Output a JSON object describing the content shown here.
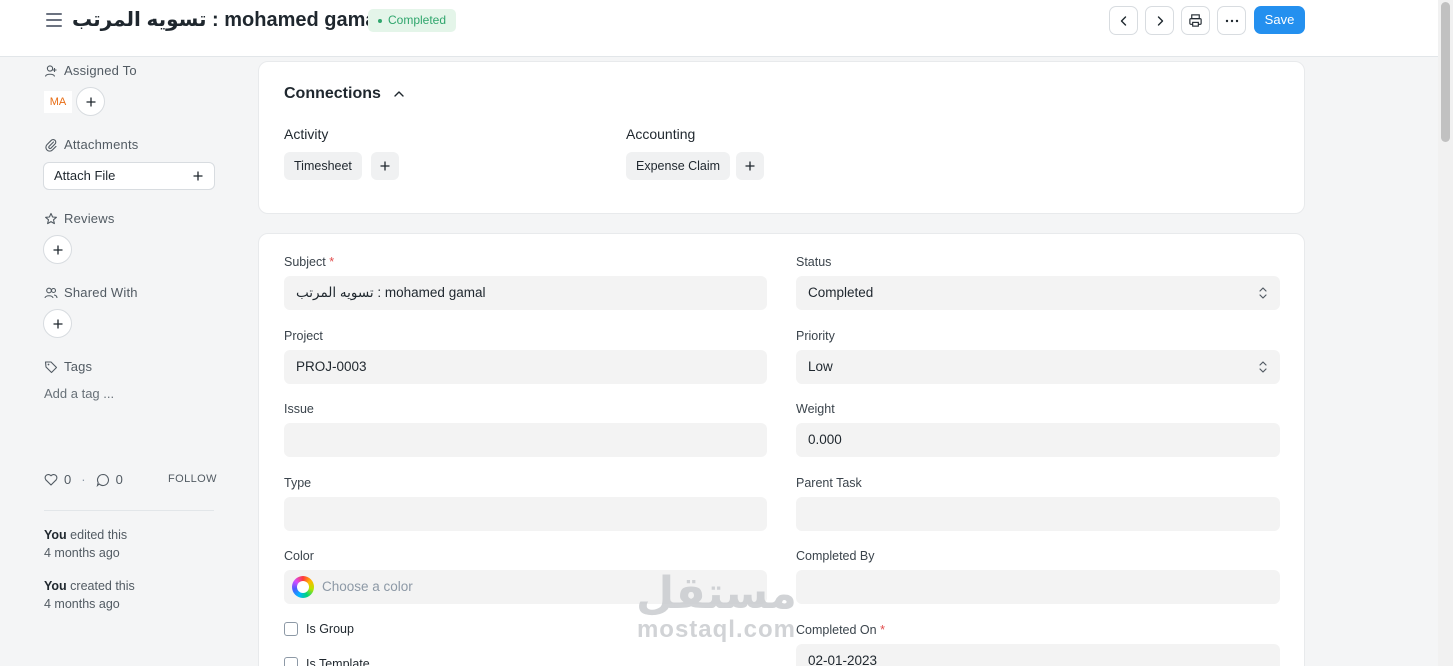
{
  "header": {
    "title": "تسويه المرتب : mohamed gamal",
    "status": "Completed",
    "save_label": "Save"
  },
  "sidebar": {
    "assigned_to": {
      "label": "Assigned To",
      "avatar": "MA"
    },
    "attachments": {
      "label": "Attachments",
      "attach_button": "Attach File"
    },
    "reviews": {
      "label": "Reviews"
    },
    "shared_with": {
      "label": "Shared With"
    },
    "tags": {
      "label": "Tags",
      "add_placeholder": "Add a tag ..."
    },
    "likes_count": "0",
    "comments_count": "0",
    "follow_label": "FOLLOW",
    "activity": [
      {
        "actor": "You",
        "action": "edited this",
        "time": "4 months ago"
      },
      {
        "actor": "You",
        "action": "created this",
        "time": "4 months ago"
      }
    ]
  },
  "connections": {
    "title": "Connections",
    "groups": [
      {
        "label": "Activity",
        "items": [
          "Timesheet"
        ]
      },
      {
        "label": "Accounting",
        "items": [
          "Expense Claim"
        ]
      }
    ]
  },
  "form": {
    "subject": {
      "label": "Subject",
      "value": "تسويه المرتب : mohamed gamal"
    },
    "status": {
      "label": "Status",
      "value": "Completed"
    },
    "project": {
      "label": "Project",
      "value": "PROJ-0003"
    },
    "priority": {
      "label": "Priority",
      "value": "Low"
    },
    "issue": {
      "label": "Issue",
      "value": ""
    },
    "weight": {
      "label": "Weight",
      "value": "0.000"
    },
    "type": {
      "label": "Type",
      "value": ""
    },
    "parent_task": {
      "label": "Parent Task",
      "value": ""
    },
    "color": {
      "label": "Color",
      "placeholder": "Choose a color"
    },
    "completed_by": {
      "label": "Completed By",
      "value": ""
    },
    "is_group": {
      "label": "Is Group"
    },
    "is_template": {
      "label": "Is Template"
    },
    "completed_on": {
      "label": "Completed On",
      "value": "02-01-2023"
    }
  },
  "watermark": {
    "arabic": "مستقل",
    "latin": "mostaql.com"
  },
  "colors": {
    "primary": "#2490ef",
    "success": "#30a66d",
    "required": "#e24c4c"
  }
}
